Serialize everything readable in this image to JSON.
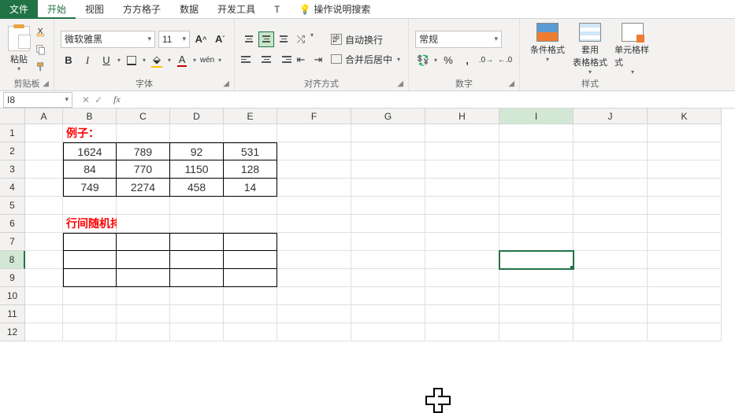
{
  "tabs": {
    "file": "文件",
    "home": "开始",
    "view": "视图",
    "square": "方方格子",
    "data": "数据",
    "dev": "开发工具",
    "t": "T",
    "tell": "操作说明搜索"
  },
  "ribbon": {
    "clipboard": {
      "paste": "粘贴",
      "label": "剪贴板"
    },
    "font": {
      "name": "微软雅黑",
      "size": "11",
      "wen": "wén",
      "label": "字体"
    },
    "alignment": {
      "wrap": "自动换行",
      "merge": "合并后居中",
      "label": "对齐方式"
    },
    "number": {
      "format": "常规",
      "label": "数字"
    },
    "styles": {
      "cond": "条件格式",
      "table": "套用\n表格格式",
      "cell": "单元格样式",
      "label": "样式"
    }
  },
  "namebox": "I8",
  "formula": "",
  "columns": [
    "A",
    "B",
    "C",
    "D",
    "E",
    "F",
    "G",
    "H",
    "I",
    "J",
    "K"
  ],
  "labels": {
    "example": "例子：",
    "randsort": "行间随机排序："
  },
  "table1": [
    [
      "1624",
      "789",
      "92",
      "531"
    ],
    [
      "84",
      "770",
      "1150",
      "128"
    ],
    [
      "749",
      "2274",
      "458",
      "14"
    ]
  ],
  "active_cell": "I8"
}
